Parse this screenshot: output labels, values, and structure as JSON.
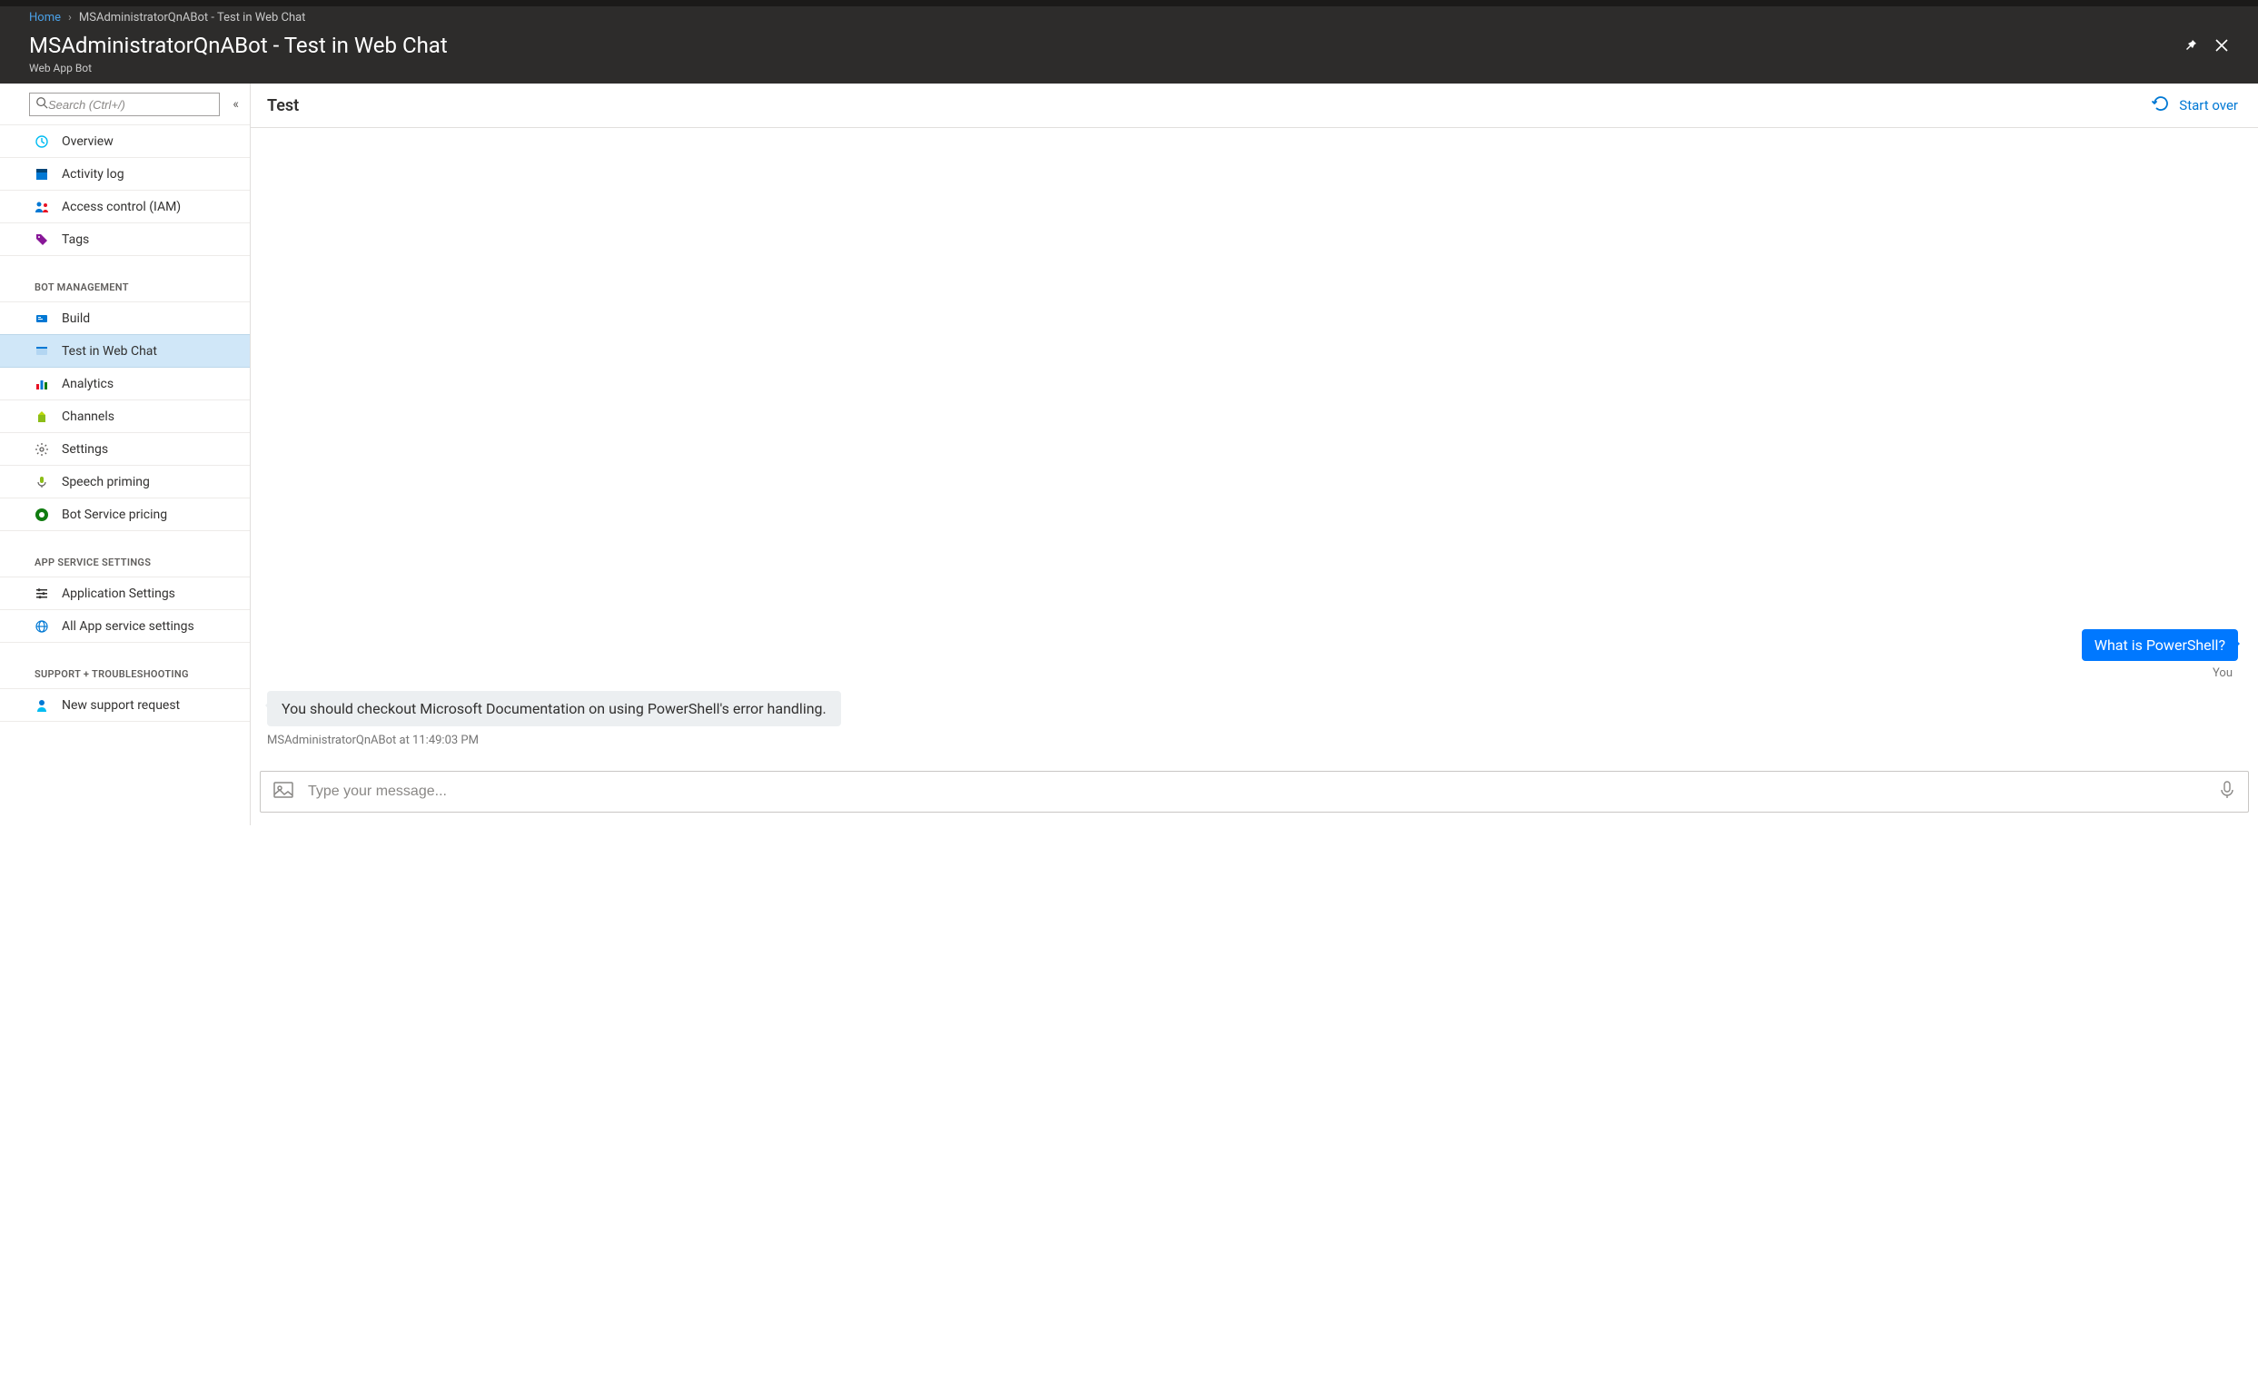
{
  "breadcrumb": {
    "home": "Home",
    "current": "MSAdministratorQnABot - Test in Web Chat"
  },
  "header": {
    "title": "MSAdministratorQnABot - Test in Web Chat",
    "subtitle": "Web App Bot"
  },
  "sidebar": {
    "search_placeholder": "Search (Ctrl+/)",
    "items_top": [
      {
        "label": "Overview"
      },
      {
        "label": "Activity log"
      },
      {
        "label": "Access control (IAM)"
      },
      {
        "label": "Tags"
      }
    ],
    "section_bot": "BOT MANAGEMENT",
    "items_bot": [
      {
        "label": "Build"
      },
      {
        "label": "Test in Web Chat"
      },
      {
        "label": "Analytics"
      },
      {
        "label": "Channels"
      },
      {
        "label": "Settings"
      },
      {
        "label": "Speech priming"
      },
      {
        "label": "Bot Service pricing"
      }
    ],
    "section_app": "APP SERVICE SETTINGS",
    "items_app": [
      {
        "label": "Application Settings"
      },
      {
        "label": "All App service settings"
      }
    ],
    "section_support": "SUPPORT + TROUBLESHOOTING",
    "items_support": [
      {
        "label": "New support request"
      }
    ]
  },
  "content": {
    "title": "Test",
    "start_over": "Start over"
  },
  "chat": {
    "user_msg": "What is PowerShell?",
    "user_meta": "You",
    "bot_msg": "You should checkout Microsoft Documentation on using PowerShell's error handling.",
    "bot_meta": "MSAdministratorQnABot at 11:49:03 PM",
    "input_placeholder": "Type your message..."
  }
}
